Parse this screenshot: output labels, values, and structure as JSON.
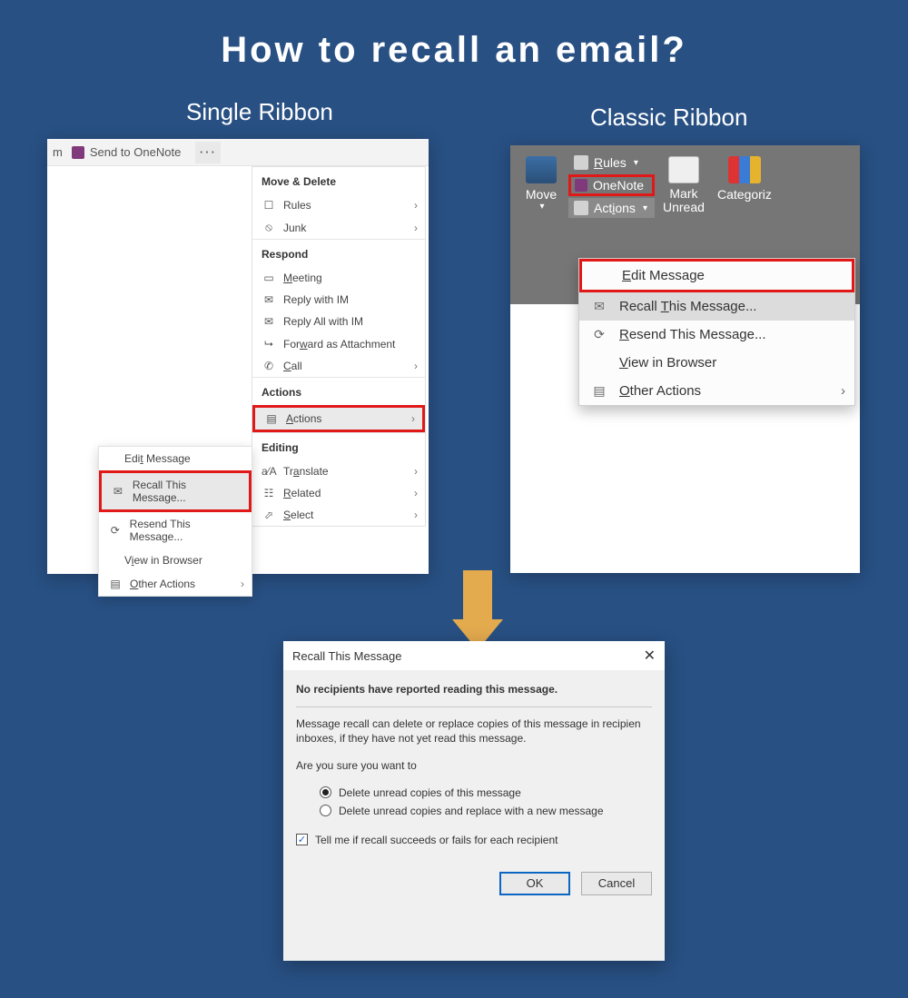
{
  "title": "How to recall an email?",
  "subtitles": {
    "left": "Single Ribbon",
    "right": "Classic Ribbon"
  },
  "single": {
    "topbar": {
      "partial": "m",
      "send_to_onenote": "Send to OneNote"
    },
    "menu": {
      "groups": {
        "move_delete": {
          "header": "Move & Delete",
          "rules": "Rules",
          "junk": "Junk"
        },
        "respond": {
          "header": "Respond",
          "meeting": "Meeting",
          "reply_im": "Reply with IM",
          "reply_all_im": "Reply All with IM",
          "forward_attachment": "Forward as Attachment",
          "call": "Call"
        },
        "actions_grp": {
          "header": "Actions",
          "actions": "Actions"
        },
        "editing": {
          "header": "Editing",
          "translate": "Translate",
          "related": "Related",
          "select": "Select"
        }
      }
    },
    "submenu": {
      "edit_message": "Edit Message",
      "recall": "Recall This Message...",
      "resend": "Resend This Message...",
      "view_browser": "View in Browser",
      "other_actions": "Other Actions"
    }
  },
  "classic": {
    "ribbon": {
      "move": "Move",
      "rules": "Rules",
      "onenote": "OneNote",
      "actions": "Actions",
      "mark_unread": "Mark\nUnread",
      "categorize": "Categoriz"
    },
    "menu": {
      "edit_message": "Edit Message",
      "recall": "Recall This Message...",
      "resend": "Resend This Message...",
      "view_browser": "View in Browser",
      "other_actions": "Other Actions"
    }
  },
  "dialog": {
    "title": "Recall This Message",
    "status": "No recipients have reported reading this message.",
    "explain": "Message recall can delete or replace copies of this message in recipien inboxes, if they have not yet read this message.",
    "prompt": "Are you sure you want to",
    "opt_delete": "Delete unread copies of this message",
    "opt_replace": "Delete unread copies and replace with a new message",
    "chk_tell": "Tell me if recall succeeds or fails for each recipient",
    "ok": "OK",
    "cancel": "Cancel"
  }
}
